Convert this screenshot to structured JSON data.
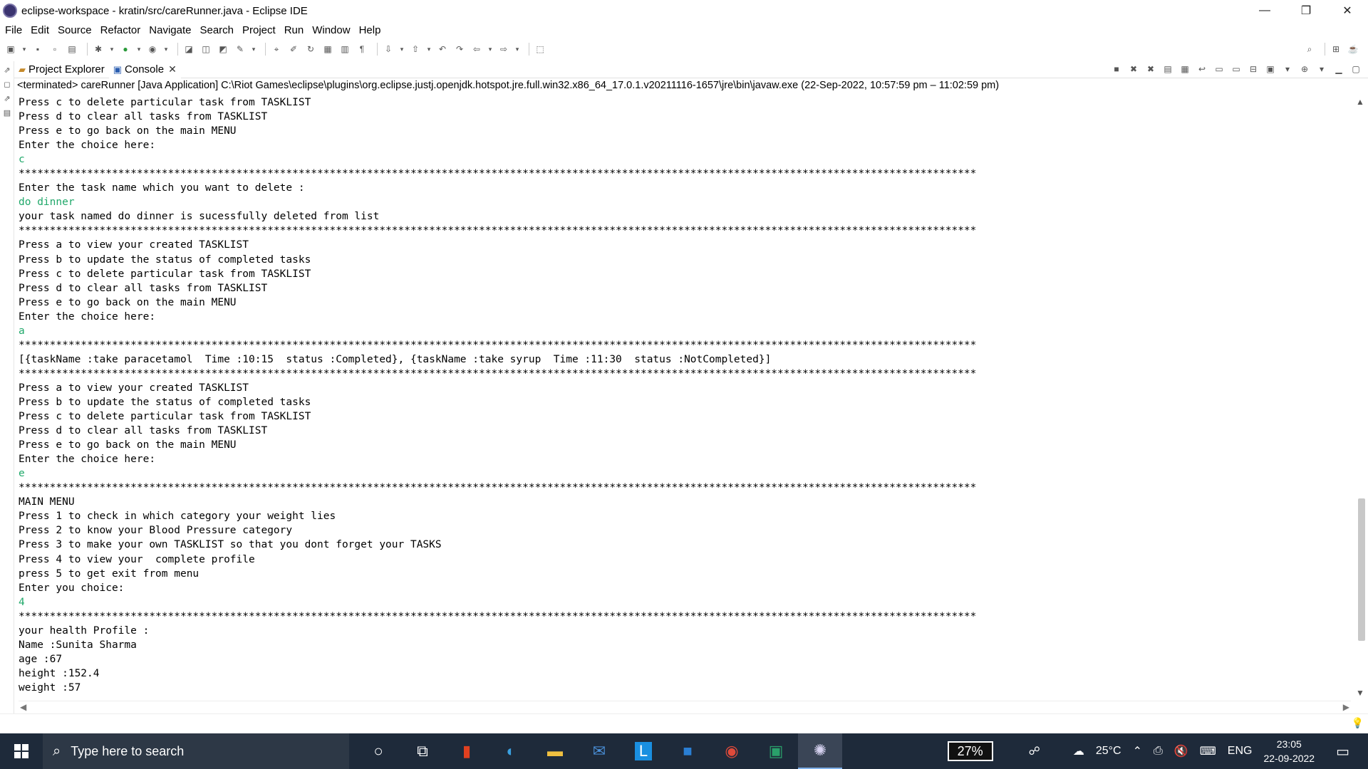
{
  "window": {
    "title": "eclipse-workspace - kratin/src/careRunner.java - Eclipse IDE",
    "minimize": "—",
    "restore": "❐",
    "close": "✕"
  },
  "menu": [
    "File",
    "Edit",
    "Source",
    "Refactor",
    "Navigate",
    "Search",
    "Project",
    "Run",
    "Window",
    "Help"
  ],
  "tabs": {
    "project_explorer": "Project Explorer",
    "console": "Console"
  },
  "console_status": "<terminated> careRunner [Java Application] C:\\Riot Games\\eclipse\\plugins\\org.eclipse.justj.openjdk.hotspot.jre.full.win32.x86_64_17.0.1.v20211116-1657\\jre\\bin\\javaw.exe  (22-Sep-2022, 10:57:59 pm – 11:02:59 pm)",
  "console_lines": [
    {
      "text": "Press c to delete particular task from TASKLIST",
      "input": false
    },
    {
      "text": "Press d to clear all tasks from TASKLIST",
      "input": false
    },
    {
      "text": "Press e to go back on the main MENU",
      "input": false
    },
    {
      "text": "Enter the choice here:",
      "input": false
    },
    {
      "text": "c",
      "input": true
    },
    {
      "text": "**********************************************************************************************************************************************************",
      "input": false
    },
    {
      "text": "Enter the task name which you want to delete :",
      "input": false
    },
    {
      "text": "do dinner",
      "input": true
    },
    {
      "text": "your task named do dinner is sucessfully deleted from list",
      "input": false
    },
    {
      "text": "**********************************************************************************************************************************************************",
      "input": false
    },
    {
      "text": "Press a to view your created TASKLIST",
      "input": false
    },
    {
      "text": "Press b to update the status of completed tasks",
      "input": false
    },
    {
      "text": "Press c to delete particular task from TASKLIST",
      "input": false
    },
    {
      "text": "Press d to clear all tasks from TASKLIST",
      "input": false
    },
    {
      "text": "Press e to go back on the main MENU",
      "input": false
    },
    {
      "text": "Enter the choice here:",
      "input": false
    },
    {
      "text": "a",
      "input": true
    },
    {
      "text": "**********************************************************************************************************************************************************",
      "input": false
    },
    {
      "text": "[{taskName :take paracetamol  Time :10:15  status :Completed}, {taskName :take syrup  Time :11:30  status :NotCompleted}]",
      "input": false
    },
    {
      "text": "**********************************************************************************************************************************************************",
      "input": false
    },
    {
      "text": "Press a to view your created TASKLIST",
      "input": false
    },
    {
      "text": "Press b to update the status of completed tasks",
      "input": false
    },
    {
      "text": "Press c to delete particular task from TASKLIST",
      "input": false
    },
    {
      "text": "Press d to clear all tasks from TASKLIST",
      "input": false
    },
    {
      "text": "Press e to go back on the main MENU",
      "input": false
    },
    {
      "text": "Enter the choice here:",
      "input": false
    },
    {
      "text": "e",
      "input": true
    },
    {
      "text": "**********************************************************************************************************************************************************",
      "input": false
    },
    {
      "text": "MAIN MENU",
      "input": false
    },
    {
      "text": "Press 1 to check in which category your weight lies",
      "input": false
    },
    {
      "text": "Press 2 to know your Blood Pressure category",
      "input": false
    },
    {
      "text": "Press 3 to make your own TASKLIST so that you dont forget your TASKS",
      "input": false
    },
    {
      "text": "Press 4 to view your  complete profile",
      "input": false
    },
    {
      "text": "press 5 to get exit from menu",
      "input": false
    },
    {
      "text": "Enter you choice:",
      "input": false
    },
    {
      "text": "4",
      "input": true
    },
    {
      "text": "**********************************************************************************************************************************************************",
      "input": false
    },
    {
      "text": "your health Profile :",
      "input": false
    },
    {
      "text": "Name :Sunita Sharma",
      "input": false
    },
    {
      "text": "age :67",
      "input": false
    },
    {
      "text": "height :152.4",
      "input": false
    },
    {
      "text": "weight :57",
      "input": false
    }
  ],
  "taskbar": {
    "search_placeholder": "Type here to search",
    "battery": "27%",
    "temperature": "25°C",
    "language": "ENG",
    "time": "23:05",
    "date": "22-09-2022"
  }
}
